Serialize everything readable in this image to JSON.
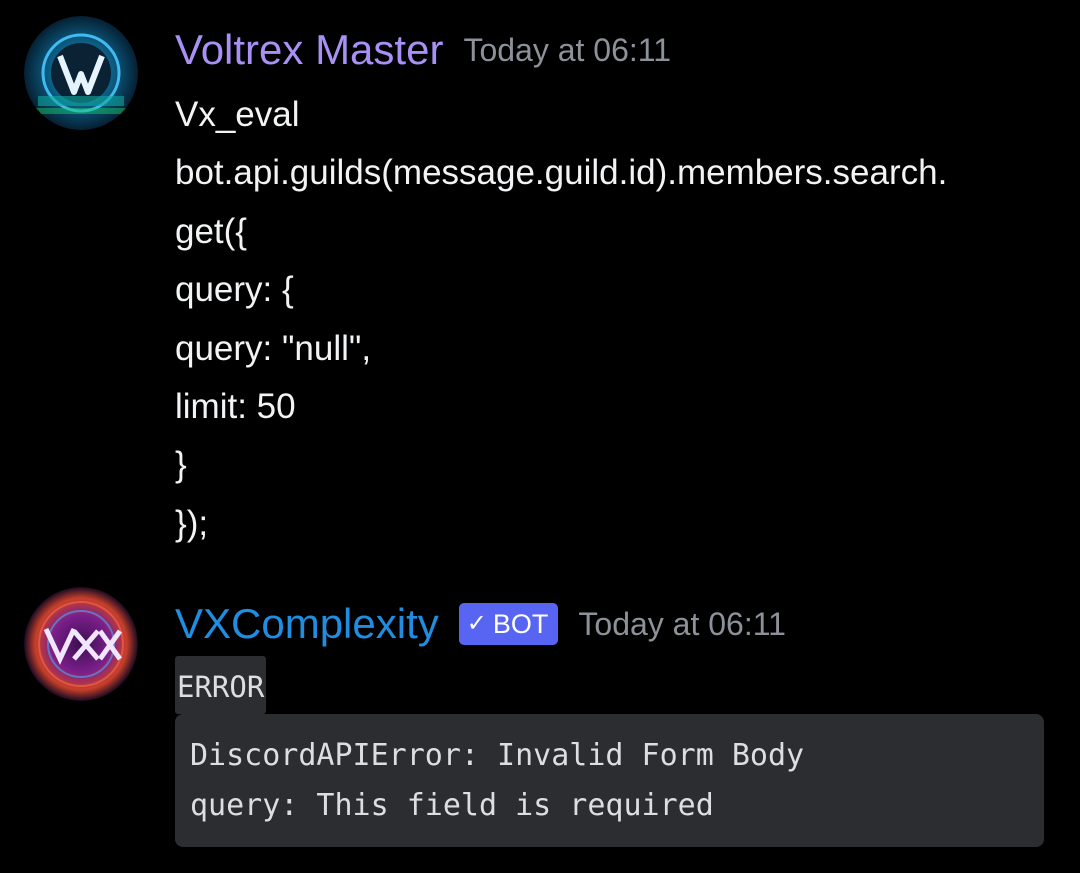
{
  "messages": [
    {
      "username": "Voltrex Master",
      "username_color": "#a890f4",
      "timestamp": "Today at 06:11",
      "avatar_icon": "voltrex-avatar",
      "lines": [
        "Vx_eval",
        "bot.api.guilds(message.guild.id).members.search.",
        "get({",
        "query: {",
        "query: \"null\",",
        "limit: 50",
        "}",
        "});"
      ]
    },
    {
      "username": "VXComplexity",
      "username_color": "#1f8ee0",
      "bot_tag": {
        "label": "BOT",
        "check": "✓",
        "color": "#5865f2"
      },
      "timestamp": "Today at 06:11",
      "avatar_icon": "vxcomplexity-avatar",
      "inline_code": "ERROR",
      "code_block": [
        "DiscordAPIError: Invalid Form Body",
        "query: This field is required"
      ]
    }
  ]
}
